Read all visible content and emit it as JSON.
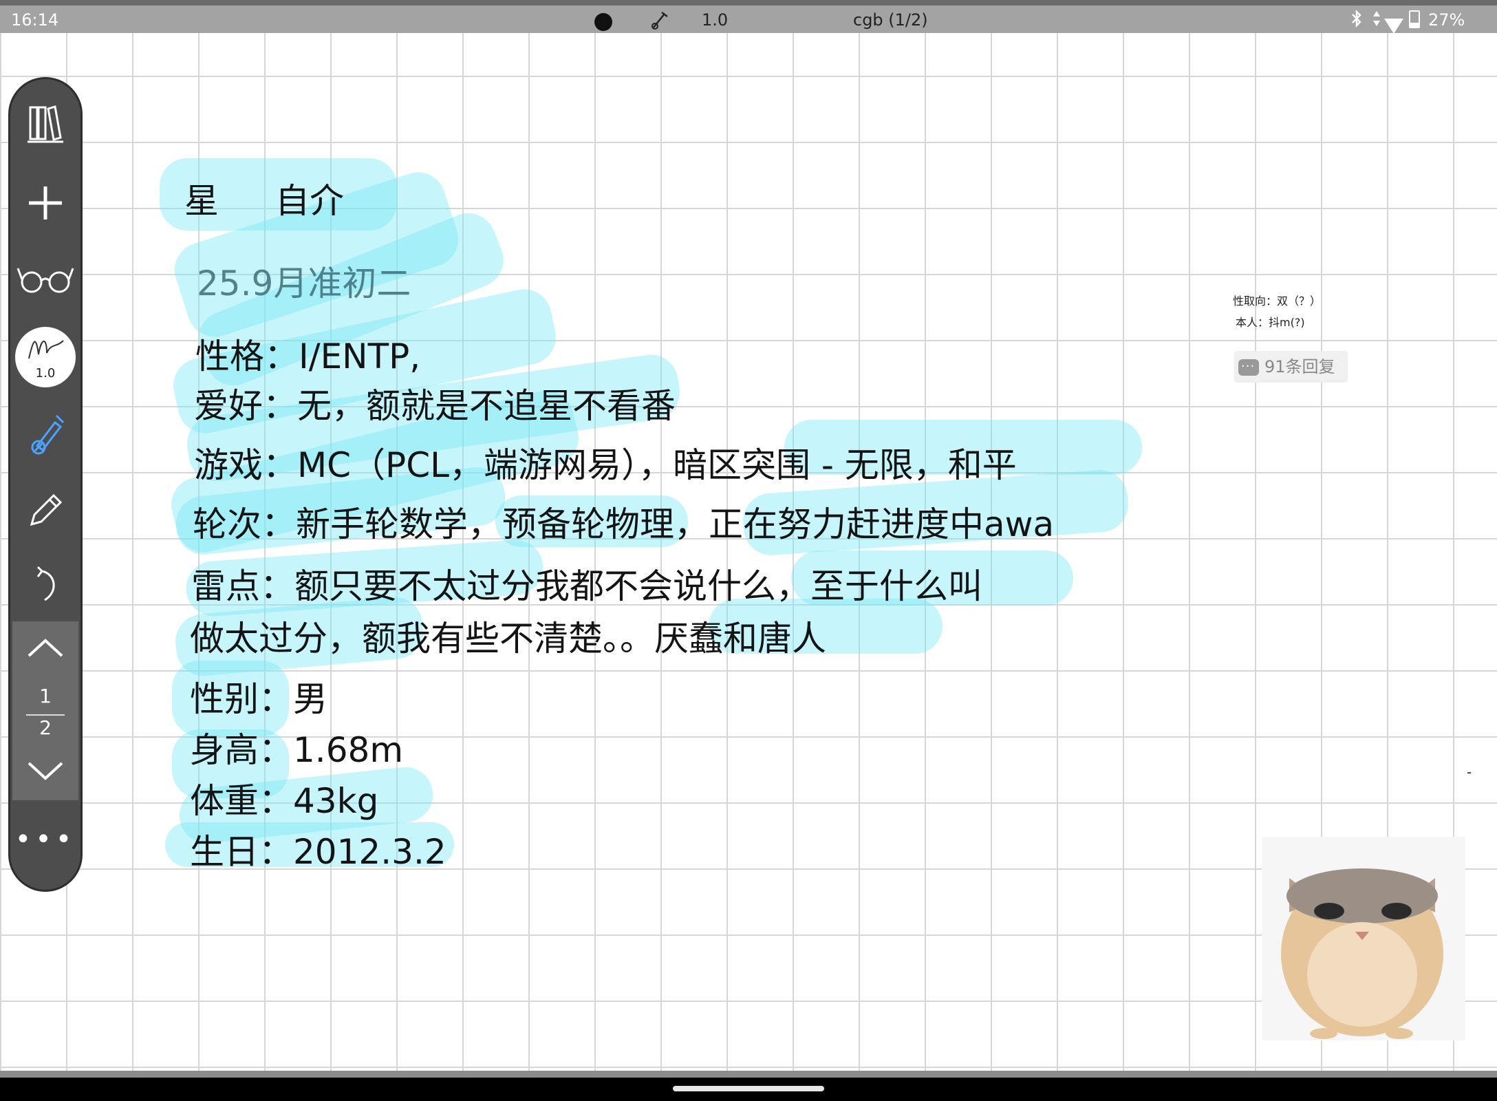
{
  "status_bar": {
    "time": "16:14",
    "brush_size": "1.0",
    "document": "cgb (1/2)",
    "battery": "27%",
    "icons": [
      "record-dot-icon",
      "brush-icon",
      "bluetooth-icon",
      "data-arrows-icon",
      "wifi-icon",
      "battery-icon"
    ]
  },
  "toolbar": {
    "icons": [
      "library-icon",
      "add-icon",
      "glasses-icon",
      "brush-icon",
      "eraser-pen-icon",
      "pencil-icon",
      "undo-icon",
      "chevron-up-icon",
      "chevron-down-icon",
      "more-icon"
    ],
    "brush_size": "1.0",
    "page_current": "1",
    "page_total": "2",
    "more": "•••"
  },
  "note": {
    "title_a": "星",
    "title_b": "自介",
    "subtitle": "25.9月准初二",
    "lines": {
      "personality": "性格：I/ENTP,",
      "hobby": "爱好：无，额就是不追星不看番",
      "games": "游戏：MC（PCL，端游网易），暗区突围 - 无限，和平",
      "round": "轮次：新手轮数学，预备轮物理，正在努力赶进度中awa",
      "dislikes_1": "雷点：额只要不太过分我都不会说什么，至于什么叫",
      "dislikes_2": "做太过分，额我有些不清楚。。厌蠢和唐人",
      "gender": "性别：男",
      "height": "身高：1.68m",
      "weight": "体重：43kg",
      "birthday": "生日：2012.3.2"
    }
  },
  "side": {
    "orientation": "性取向：双（？）",
    "self": "本人：抖m(?)",
    "replies": "91条回复"
  },
  "colors": {
    "highlight": "#78e6f5",
    "toolbar": "#4d4d4d",
    "status_bar": "#a3a3a3"
  }
}
